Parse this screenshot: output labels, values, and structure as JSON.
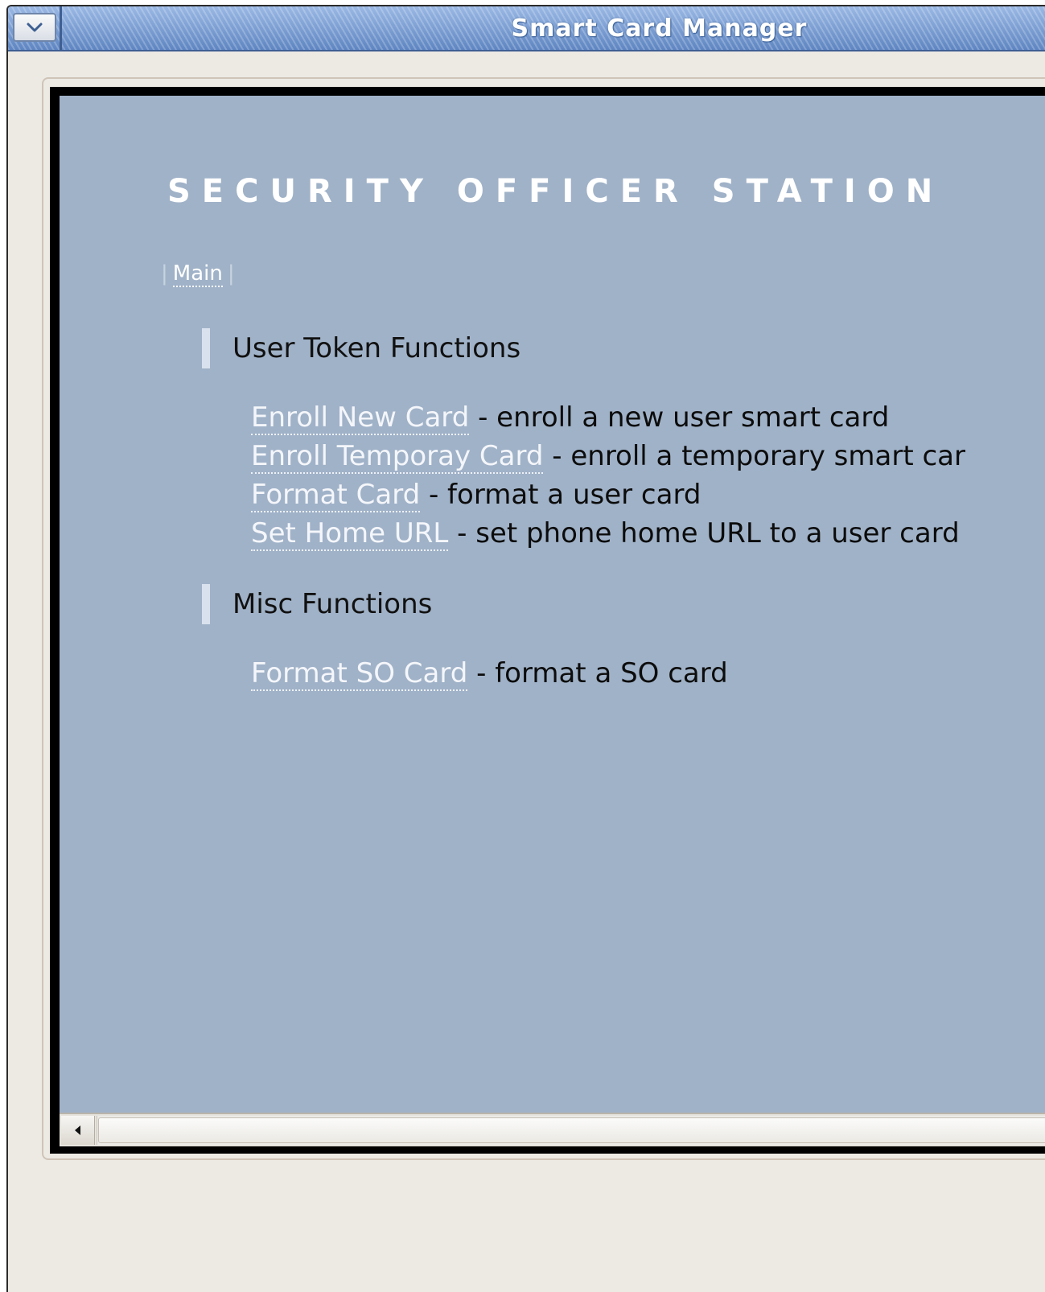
{
  "window": {
    "title": "Smart Card Manager",
    "menu_icon": "chevron-down-icon"
  },
  "page": {
    "heading": "SECURITY OFFICER STATION",
    "nav": {
      "separator": "|",
      "items": [
        "Main"
      ]
    },
    "sections": [
      {
        "title": "User Token Functions",
        "items": [
          {
            "link": "Enroll New Card",
            "desc": " - enroll a new user smart card"
          },
          {
            "link": "Enroll Temporay Card",
            "desc": " - enroll a temporary smart car"
          },
          {
            "link": "Format Card",
            "desc": " - format a user card"
          },
          {
            "link": "Set Home URL",
            "desc": " - set phone home URL to a user card"
          }
        ]
      },
      {
        "title": "Misc Functions",
        "items": [
          {
            "link": "Format SO Card",
            "desc": " - format a SO card"
          }
        ]
      }
    ]
  },
  "scrollbar": {
    "left_icon": "arrow-left-icon"
  },
  "colors": {
    "content_bg": "#a0b2c8",
    "window_bg": "#edeae4",
    "title_bar": "#7fa4d6",
    "link": "#f4f6fa"
  }
}
